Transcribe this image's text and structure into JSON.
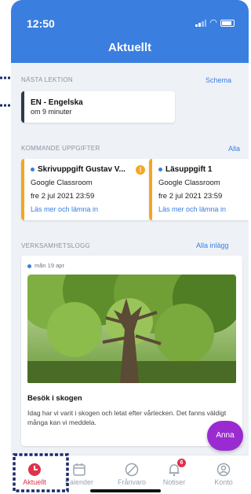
{
  "status": {
    "time": "12:50"
  },
  "header": {
    "title": "Aktuellt"
  },
  "next_lesson": {
    "section_label": "NÄSTA LEKTION",
    "link": "Schema",
    "subject": "EN - Engelska",
    "when": "om 9 minuter"
  },
  "upcoming": {
    "section_label": "KOMMANDE UPPGIFTER",
    "link": "Alla",
    "tasks": [
      {
        "title": "Skrivuppgift Gustav V...",
        "source": "Google Classroom",
        "due": "fre 2 jul 2021 23:59",
        "action": "Läs mer och lämna in",
        "warning": "!"
      },
      {
        "title": "Läsuppgift 1",
        "source": "Google Classroom",
        "due": "fre 2 jul 2021 23:59",
        "action": "Läs mer och lämna in"
      }
    ]
  },
  "activity": {
    "section_label": "VERKSAMHETSLOGG",
    "link": "Alla inlägg",
    "post": {
      "date": "mån 19 apr",
      "title": "Besök i skogen",
      "body": "Idag har vi varit i skogen och letat efter vårtecken. Det fanns väldigt många kan vi meddela."
    }
  },
  "fab": {
    "label": "Anna"
  },
  "tabs": [
    {
      "label": "Aktuellt",
      "icon": "clock-icon",
      "active": true
    },
    {
      "label": "Kalender",
      "icon": "calendar-icon"
    },
    {
      "label": "Frånvaro",
      "icon": "absence-icon"
    },
    {
      "label": "Notiser",
      "icon": "bell-icon",
      "badge": "6"
    },
    {
      "label": "Konto",
      "icon": "account-icon"
    }
  ],
  "colors": {
    "primary": "#3a7ee0",
    "task_accent": "#f5a623",
    "active_tab": "#e0314a",
    "fab": "#9a2bd0"
  }
}
